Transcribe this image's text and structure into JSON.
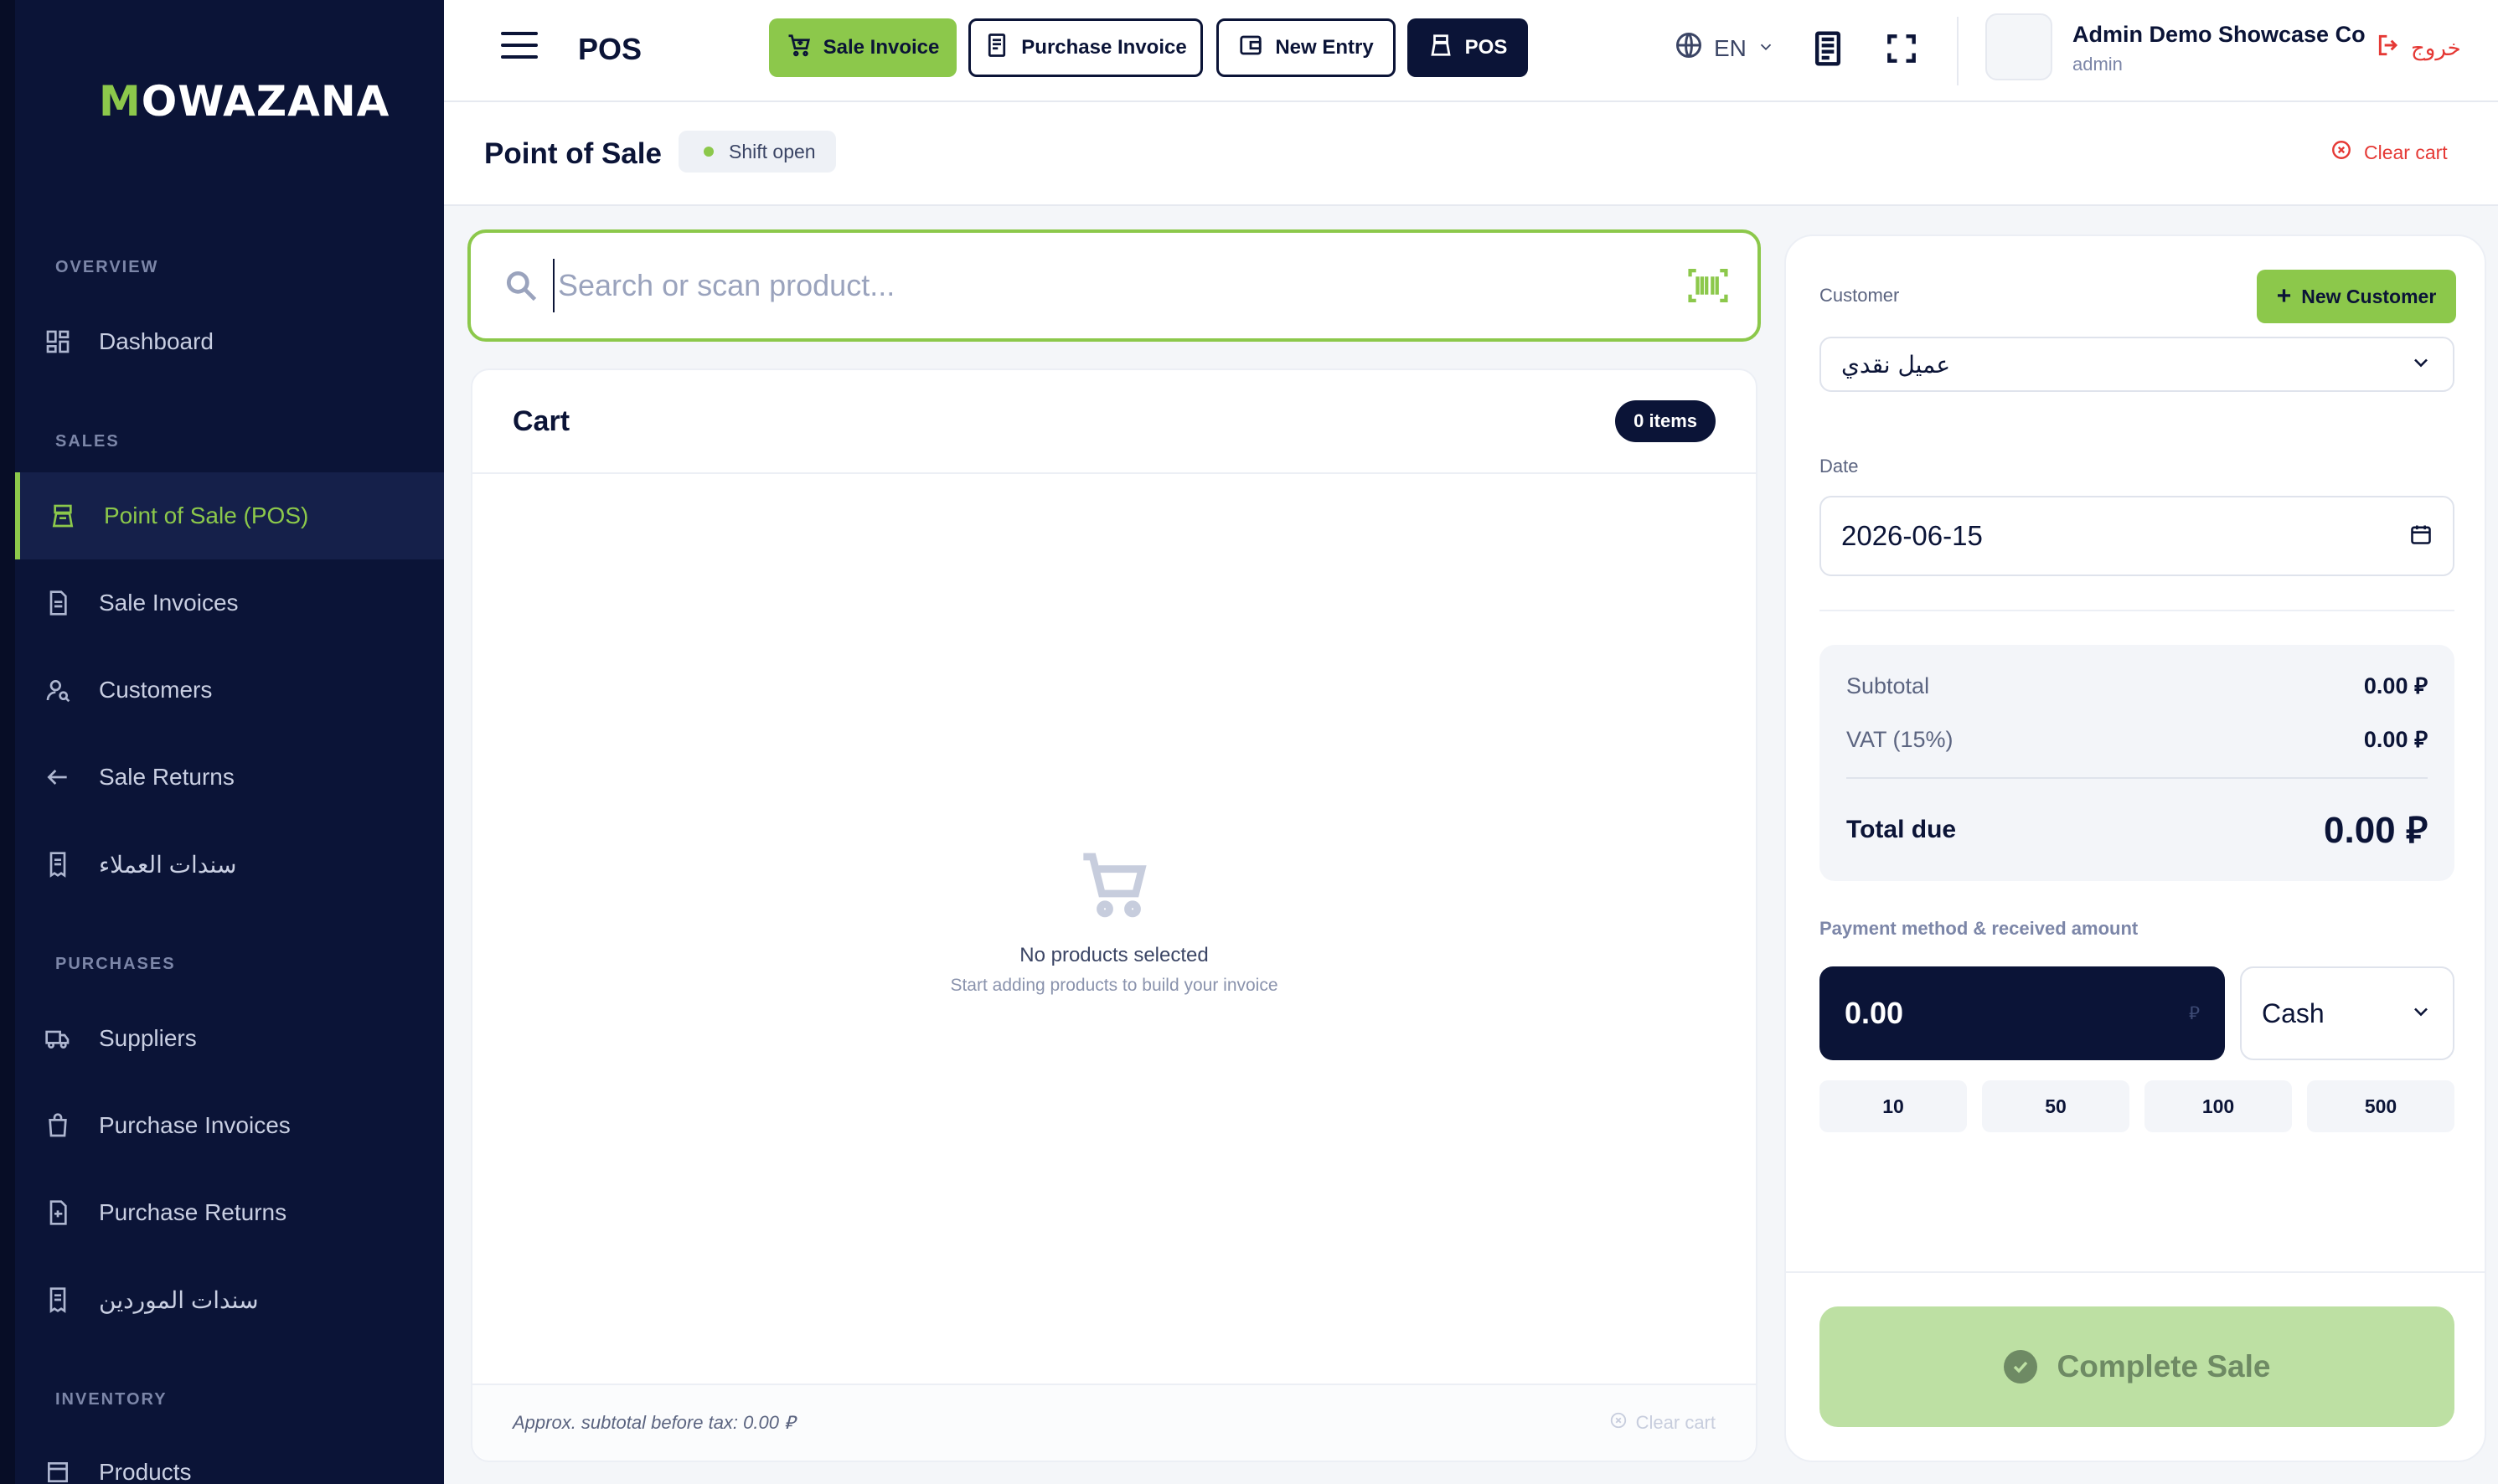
{
  "brand": {
    "logo_prefix": "M",
    "logo_rest": "OWAZANA"
  },
  "sidebar": {
    "sections": {
      "overview": "OVERVIEW",
      "sales": "SALES",
      "purchases": "PURCHASES",
      "inventory": "INVENTORY"
    },
    "items": [
      {
        "label": "Dashboard",
        "icon": "dashboard-icon"
      },
      {
        "label": "Point of Sale (POS)",
        "icon": "pos-icon",
        "active": true
      },
      {
        "label": "Sale Invoices",
        "icon": "invoice-icon"
      },
      {
        "label": "Customers",
        "icon": "customers-icon"
      },
      {
        "label": "Sale Returns",
        "icon": "return-icon"
      },
      {
        "label": "سندات العملاء",
        "icon": "receipt-icon"
      },
      {
        "label": "Suppliers",
        "icon": "truck-icon"
      },
      {
        "label": "Purchase Invoices",
        "icon": "bag-icon"
      },
      {
        "label": "Purchase Returns",
        "icon": "return-box-icon"
      },
      {
        "label": "سندات الموردين",
        "icon": "receipt-icon"
      },
      {
        "label": "Products",
        "icon": "products-icon"
      }
    ]
  },
  "topbar": {
    "title": "POS",
    "buttons": {
      "sale_invoice": "Sale Invoice",
      "purchase_invoice": "Purchase Invoice",
      "new_entry": "New Entry",
      "pos": "POS"
    },
    "language": "EN",
    "user_name": "Admin Demo Showcase Co",
    "user_role": "admin",
    "logout": "خروج"
  },
  "page": {
    "title": "Point of Sale",
    "shift_status": "Shift open",
    "clear_cart": "Clear cart"
  },
  "search": {
    "placeholder": "Search or scan product..."
  },
  "cart": {
    "title": "Cart",
    "count_label": "0 items",
    "empty_title": "No products selected",
    "empty_subtitle": "Start adding products to build your invoice",
    "approx_subtotal": "Approx. subtotal before tax: 0.00 ⃁",
    "clear_cart": "Clear cart"
  },
  "checkout": {
    "customer_label": "Customer",
    "new_customer": "New Customer",
    "customer_value": "عميل نقدي",
    "date_label": "Date",
    "date_value": "2026-06-15",
    "subtotal_label": "Subtotal",
    "subtotal_value": "0.00 ⃁",
    "vat_label": "VAT (15%)",
    "vat_value": "0.00 ⃁",
    "total_label": "Total due",
    "total_value": "0.00 ⃁",
    "payment_label": "Payment method & received amount",
    "received_amount": "0.00",
    "currency_symbol": "⃁",
    "payment_method": "Cash",
    "quick_amounts": [
      "10",
      "50",
      "100",
      "500"
    ],
    "complete_label": "Complete Sale"
  },
  "colors": {
    "navy": "#0b1437",
    "accent_green": "#8cc84b",
    "danger": "#e53935"
  }
}
